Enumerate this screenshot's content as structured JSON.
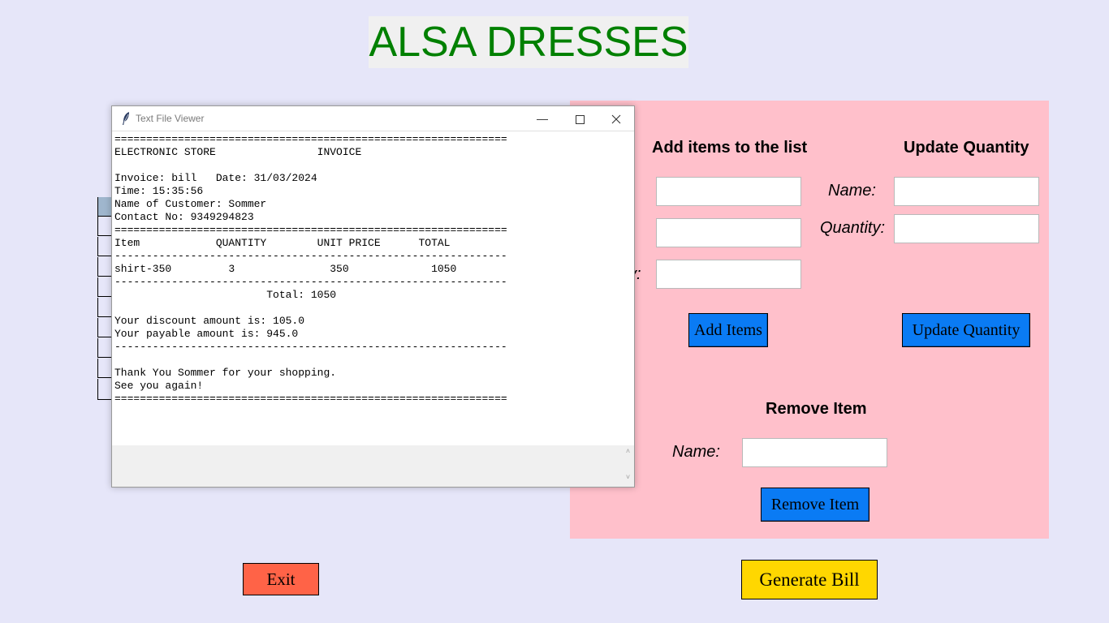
{
  "app": {
    "title": "ALSA DRESSES"
  },
  "add_items": {
    "heading": "Add items to the list",
    "name_label_partial": ":",
    "quantity_label_partial": "y:",
    "name_value": "",
    "price_value": "",
    "quantity_value": "",
    "button_label": "Add Items"
  },
  "update_quantity": {
    "heading": "Update Quantity",
    "name_label": "Name:",
    "quantity_label": "Quantity:",
    "name_value": "",
    "quantity_value": "",
    "button_label": "Update Quantity"
  },
  "remove_item": {
    "heading": "Remove Item",
    "name_label": "Name:",
    "name_value": "",
    "button_label": "Remove Item"
  },
  "buttons": {
    "exit_label": "Exit",
    "generate_bill_label": "Generate Bill"
  },
  "colors": {
    "background": "#e6e6f9",
    "panel": "#ffc0cb",
    "title_text": "#008000",
    "blue_button": "#0a7bf4",
    "exit_button": "#ff6347",
    "generate_button": "#ffd700"
  },
  "viewer": {
    "window_title": "Text File Viewer",
    "app_icon": "feather-icon",
    "invoice_text": "==============================================================\nELECTRONIC STORE                INVOICE\n\nInvoice: bill   Date: 31/03/2024\nTime: 15:35:56\nName of Customer: Sommer\nContact No: 9349294823\n==============================================================\nItem            QUANTITY        UNIT PRICE      TOTAL\n--------------------------------------------------------------\nshirt-350         3               350             1050\n--------------------------------------------------------------\n                        Total: 1050\n\nYour discount amount is: 105.0\nYour payable amount is: 945.0\n--------------------------------------------------------------\n\nThank You Sommer for your shopping.\nSee you again!\n=============================================================="
  }
}
